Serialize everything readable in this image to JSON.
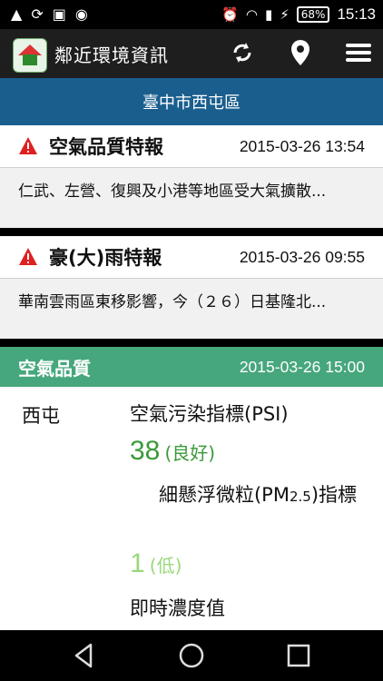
{
  "status": {
    "time": "15:13",
    "battery": "68%"
  },
  "app": {
    "title": "鄰近環境資訊",
    "icons": [
      "refresh-icon",
      "location-pin-icon",
      "menu-icon"
    ]
  },
  "location": "臺中市西屯區",
  "alerts": [
    {
      "title": "空氣品質特報",
      "date": "2015-03-26 13:54",
      "body": "仁武、左營、復興及小港等地區受大氣擴散..."
    },
    {
      "title": "豪(大)雨特報",
      "date": "2015-03-26 09:55",
      "body": "華南雲雨區東移影響，今（２６）日基隆北..."
    }
  ],
  "air_quality": {
    "title": "空氣品質",
    "date": "2015-03-26 15:00",
    "station": "西屯",
    "psi_label": "空氣污染指標(PSI)",
    "psi_value": "38",
    "psi_level": "(良好)",
    "pm_label_a": "細懸浮微粒(PM",
    "pm_label_sub": "2.5",
    "pm_label_b": ")指標",
    "pm_value": "1",
    "pm_level": "(低)",
    "realtime_label": "即時濃度值"
  },
  "colors": {
    "location_bar": "#1a5e8e",
    "air_quality_header": "#46a77c",
    "psi_good": "#3a9a3a",
    "pm_low": "#9ad87a",
    "warning": "#e02020"
  }
}
